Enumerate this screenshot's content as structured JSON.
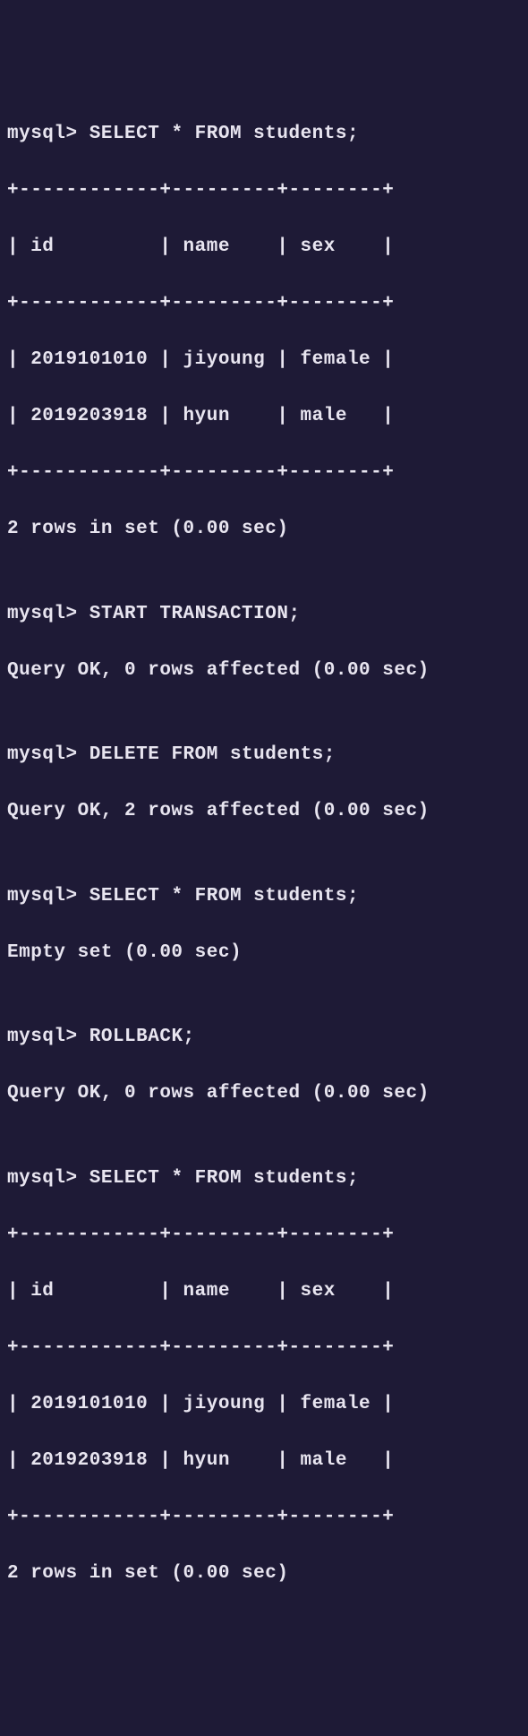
{
  "prompt": "mysql>",
  "commands": {
    "select1": "SELECT * FROM students;",
    "start_tx": "START TRANSACTION;",
    "delete": "DELETE FROM students;",
    "select2": "SELECT * FROM students;",
    "rollback": "ROLLBACK;",
    "select3": "SELECT * FROM students;"
  },
  "table1": {
    "border_top": "+------------+---------+--------+",
    "header_row": "| id         | name    | sex    |",
    "border_mid": "+------------+---------+--------+",
    "row1": "| 2019101010 | jiyoung | female |",
    "row2": "| 2019203918 | hyun    | male   |",
    "border_bot": "+------------+---------+--------+",
    "footer": "2 rows in set (0.00 sec)"
  },
  "responses": {
    "ok0": "Query OK, 0 rows affected (0.00 sec)",
    "ok2": "Query OK, 2 rows affected (0.00 sec)",
    "empty": "Empty set (0.00 sec)"
  },
  "table2": {
    "border_top": "+------------+---------+--------+",
    "header_row": "| id         | name    | sex    |",
    "border_mid": "+------------+---------+--------+",
    "row1": "| 2019101010 | jiyoung | female |",
    "row2": "| 2019203918 | hyun    | male   |",
    "border_bot": "+------------+---------+--------+",
    "footer": "2 rows in set (0.00 sec)"
  },
  "blank": ""
}
